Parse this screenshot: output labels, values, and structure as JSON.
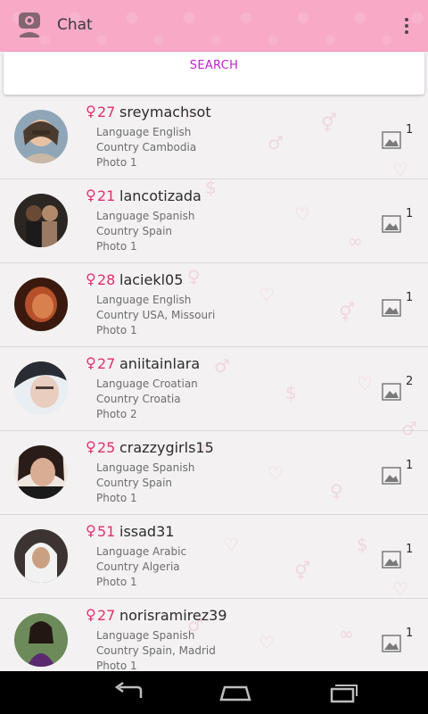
{
  "app": {
    "title": "Chat",
    "icon": "chat-app-icon",
    "overflow_icon": "overflow-menu-icon"
  },
  "search": {
    "label": "SEARCH"
  },
  "colors": {
    "topbar": "#f7a9c6",
    "accent_female": "#e0306f",
    "search_text": "#c51fd6"
  },
  "users": [
    {
      "gender_icon": "female-icon",
      "age": "27",
      "username": "sreymachsot",
      "language": "Language English",
      "country": "Country Cambodia",
      "photo": "Photo 1",
      "photo_count": "1"
    },
    {
      "gender_icon": "female-icon",
      "age": "21",
      "username": "lancotizada",
      "language": "Language Spanish",
      "country": "Country Spain",
      "photo": "Photo 1",
      "photo_count": "1"
    },
    {
      "gender_icon": "female-icon",
      "age": "28",
      "username": "laciekl05",
      "language": "Language English",
      "country": "Country USA, Missouri",
      "photo": "Photo 1",
      "photo_count": "1"
    },
    {
      "gender_icon": "female-icon",
      "age": "27",
      "username": "aniitainlara",
      "language": "Language Croatian",
      "country": "Country Croatia",
      "photo": "Photo 2",
      "photo_count": "2"
    },
    {
      "gender_icon": "female-icon",
      "age": "25",
      "username": "crazzygirls15",
      "language": "Language Spanish",
      "country": "Country Spain",
      "photo": "Photo 1",
      "photo_count": "1"
    },
    {
      "gender_icon": "female-icon",
      "age": "51",
      "username": "issad31",
      "language": "Language Arabic",
      "country": "Country Algeria",
      "photo": "Photo 1",
      "photo_count": "1"
    },
    {
      "gender_icon": "female-icon",
      "age": "27",
      "username": "norisramirez39",
      "language": "Language Spanish",
      "country": "Country Spain, Madrid",
      "photo": "Photo 1",
      "photo_count": "1"
    }
  ],
  "navbar": {
    "back_icon": "back-icon",
    "home_icon": "home-icon",
    "recents_icon": "recents-icon"
  }
}
